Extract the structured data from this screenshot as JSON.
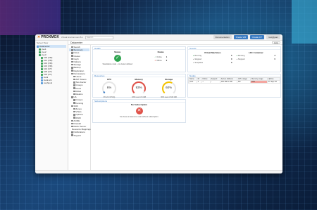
{
  "header": {
    "logo_text": "PROXMOX",
    "version": "Virtual Environment 8.x",
    "search_placeholder": "Search",
    "buttons": [
      "Documentation",
      "Create VM",
      "Create CT",
      "root@pam"
    ]
  },
  "tree": {
    "title": "Server View",
    "items": [
      "Datacenter",
      "pve1",
      "pve2",
      "pve3",
      "100 (VM)",
      "101 (VM)",
      "102 (VM)",
      "103 (VM)",
      "104 (CT)",
      "105 (CT)",
      "106 (CT)",
      "local",
      "local-lvm",
      "cephpool"
    ]
  },
  "breadcrumb": {
    "title": "Datacenter",
    "help": "Help"
  },
  "menu": {
    "items": [
      {
        "label": "Search",
        "sub": false
      },
      {
        "label": "Summary",
        "sub": false
      },
      {
        "label": "Notes",
        "sub": false
      },
      {
        "label": "Cluster",
        "sub": false
      },
      {
        "label": "Ceph",
        "sub": false
      },
      {
        "label": "Options",
        "sub": false
      },
      {
        "label": "Storage",
        "sub": false
      },
      {
        "label": "Backup",
        "sub": false
      },
      {
        "label": "Replication",
        "sub": false
      },
      {
        "label": "Permissions",
        "sub": false
      },
      {
        "label": "Users",
        "sub": true
      },
      {
        "label": "API Tokens",
        "sub": true
      },
      {
        "label": "Two Factor",
        "sub": true
      },
      {
        "label": "Groups",
        "sub": true
      },
      {
        "label": "Pools",
        "sub": true
      },
      {
        "label": "Roles",
        "sub": true
      },
      {
        "label": "Realms",
        "sub": true
      },
      {
        "label": "HA",
        "sub": false
      },
      {
        "label": "Groups",
        "sub": true
      },
      {
        "label": "Fencing",
        "sub": true
      },
      {
        "label": "SDN",
        "sub": false
      },
      {
        "label": "Zones",
        "sub": true
      },
      {
        "label": "VNets",
        "sub": true
      },
      {
        "label": "Options",
        "sub": true
      },
      {
        "label": "IPAM",
        "sub": true
      },
      {
        "label": "ACME",
        "sub": false
      },
      {
        "label": "Firewall",
        "sub": false
      },
      {
        "label": "Metric Server",
        "sub": false
      },
      {
        "label": "Resource Mappings",
        "sub": false
      },
      {
        "label": "Notifications",
        "sub": false
      },
      {
        "label": "Support",
        "sub": false
      }
    ]
  },
  "health": {
    "title": "Health",
    "status_label": "Status",
    "status_text": "Standalone node - no cluster defined",
    "nodes_label": "Nodes",
    "online_label": "Online",
    "online_count": "1",
    "offline_label": "Offline",
    "offline_count": "0"
  },
  "guests": {
    "title": "Guests",
    "vm_label": "Virtual Machines",
    "lxc_label": "LXC Container",
    "vm_rows": [
      [
        "Running",
        "5"
      ],
      [
        "Stopped",
        "0"
      ],
      [
        "Templates",
        "0"
      ]
    ],
    "lxc_rows": [
      [
        "Running",
        "3"
      ],
      [
        "Stopped",
        "0"
      ]
    ]
  },
  "resources": {
    "title": "Resources",
    "gauges": [
      {
        "label": "CPU",
        "value": "6%",
        "pct": 6,
        "sub": "6% of 4 CPU(s)",
        "color": "#3b7dc4"
      },
      {
        "label": "Memory",
        "value": "93%",
        "pct": 93,
        "sub": "93% used of 4 GiB",
        "color": "#e0534a"
      },
      {
        "label": "Storage",
        "value": "60%",
        "pct": 60,
        "sub": "60% used of 100 GiB",
        "color": "#f5c400"
      }
    ]
  },
  "nodes_table": {
    "title": "Nodes",
    "headers": [
      "Name",
      "ID",
      "Online",
      "Support",
      "Server Address",
      "CPU usage",
      "Memory usage",
      "Uptime"
    ],
    "rows": [
      [
        "pve1",
        "1",
        "✓",
        "-",
        "192.168.1.100",
        "6%",
        "93%",
        "27 days 04"
      ]
    ]
  },
  "subscriptions": {
    "title": "Subscriptions",
    "heading": "No Subscription",
    "text": "You have at least one node without subscription."
  }
}
